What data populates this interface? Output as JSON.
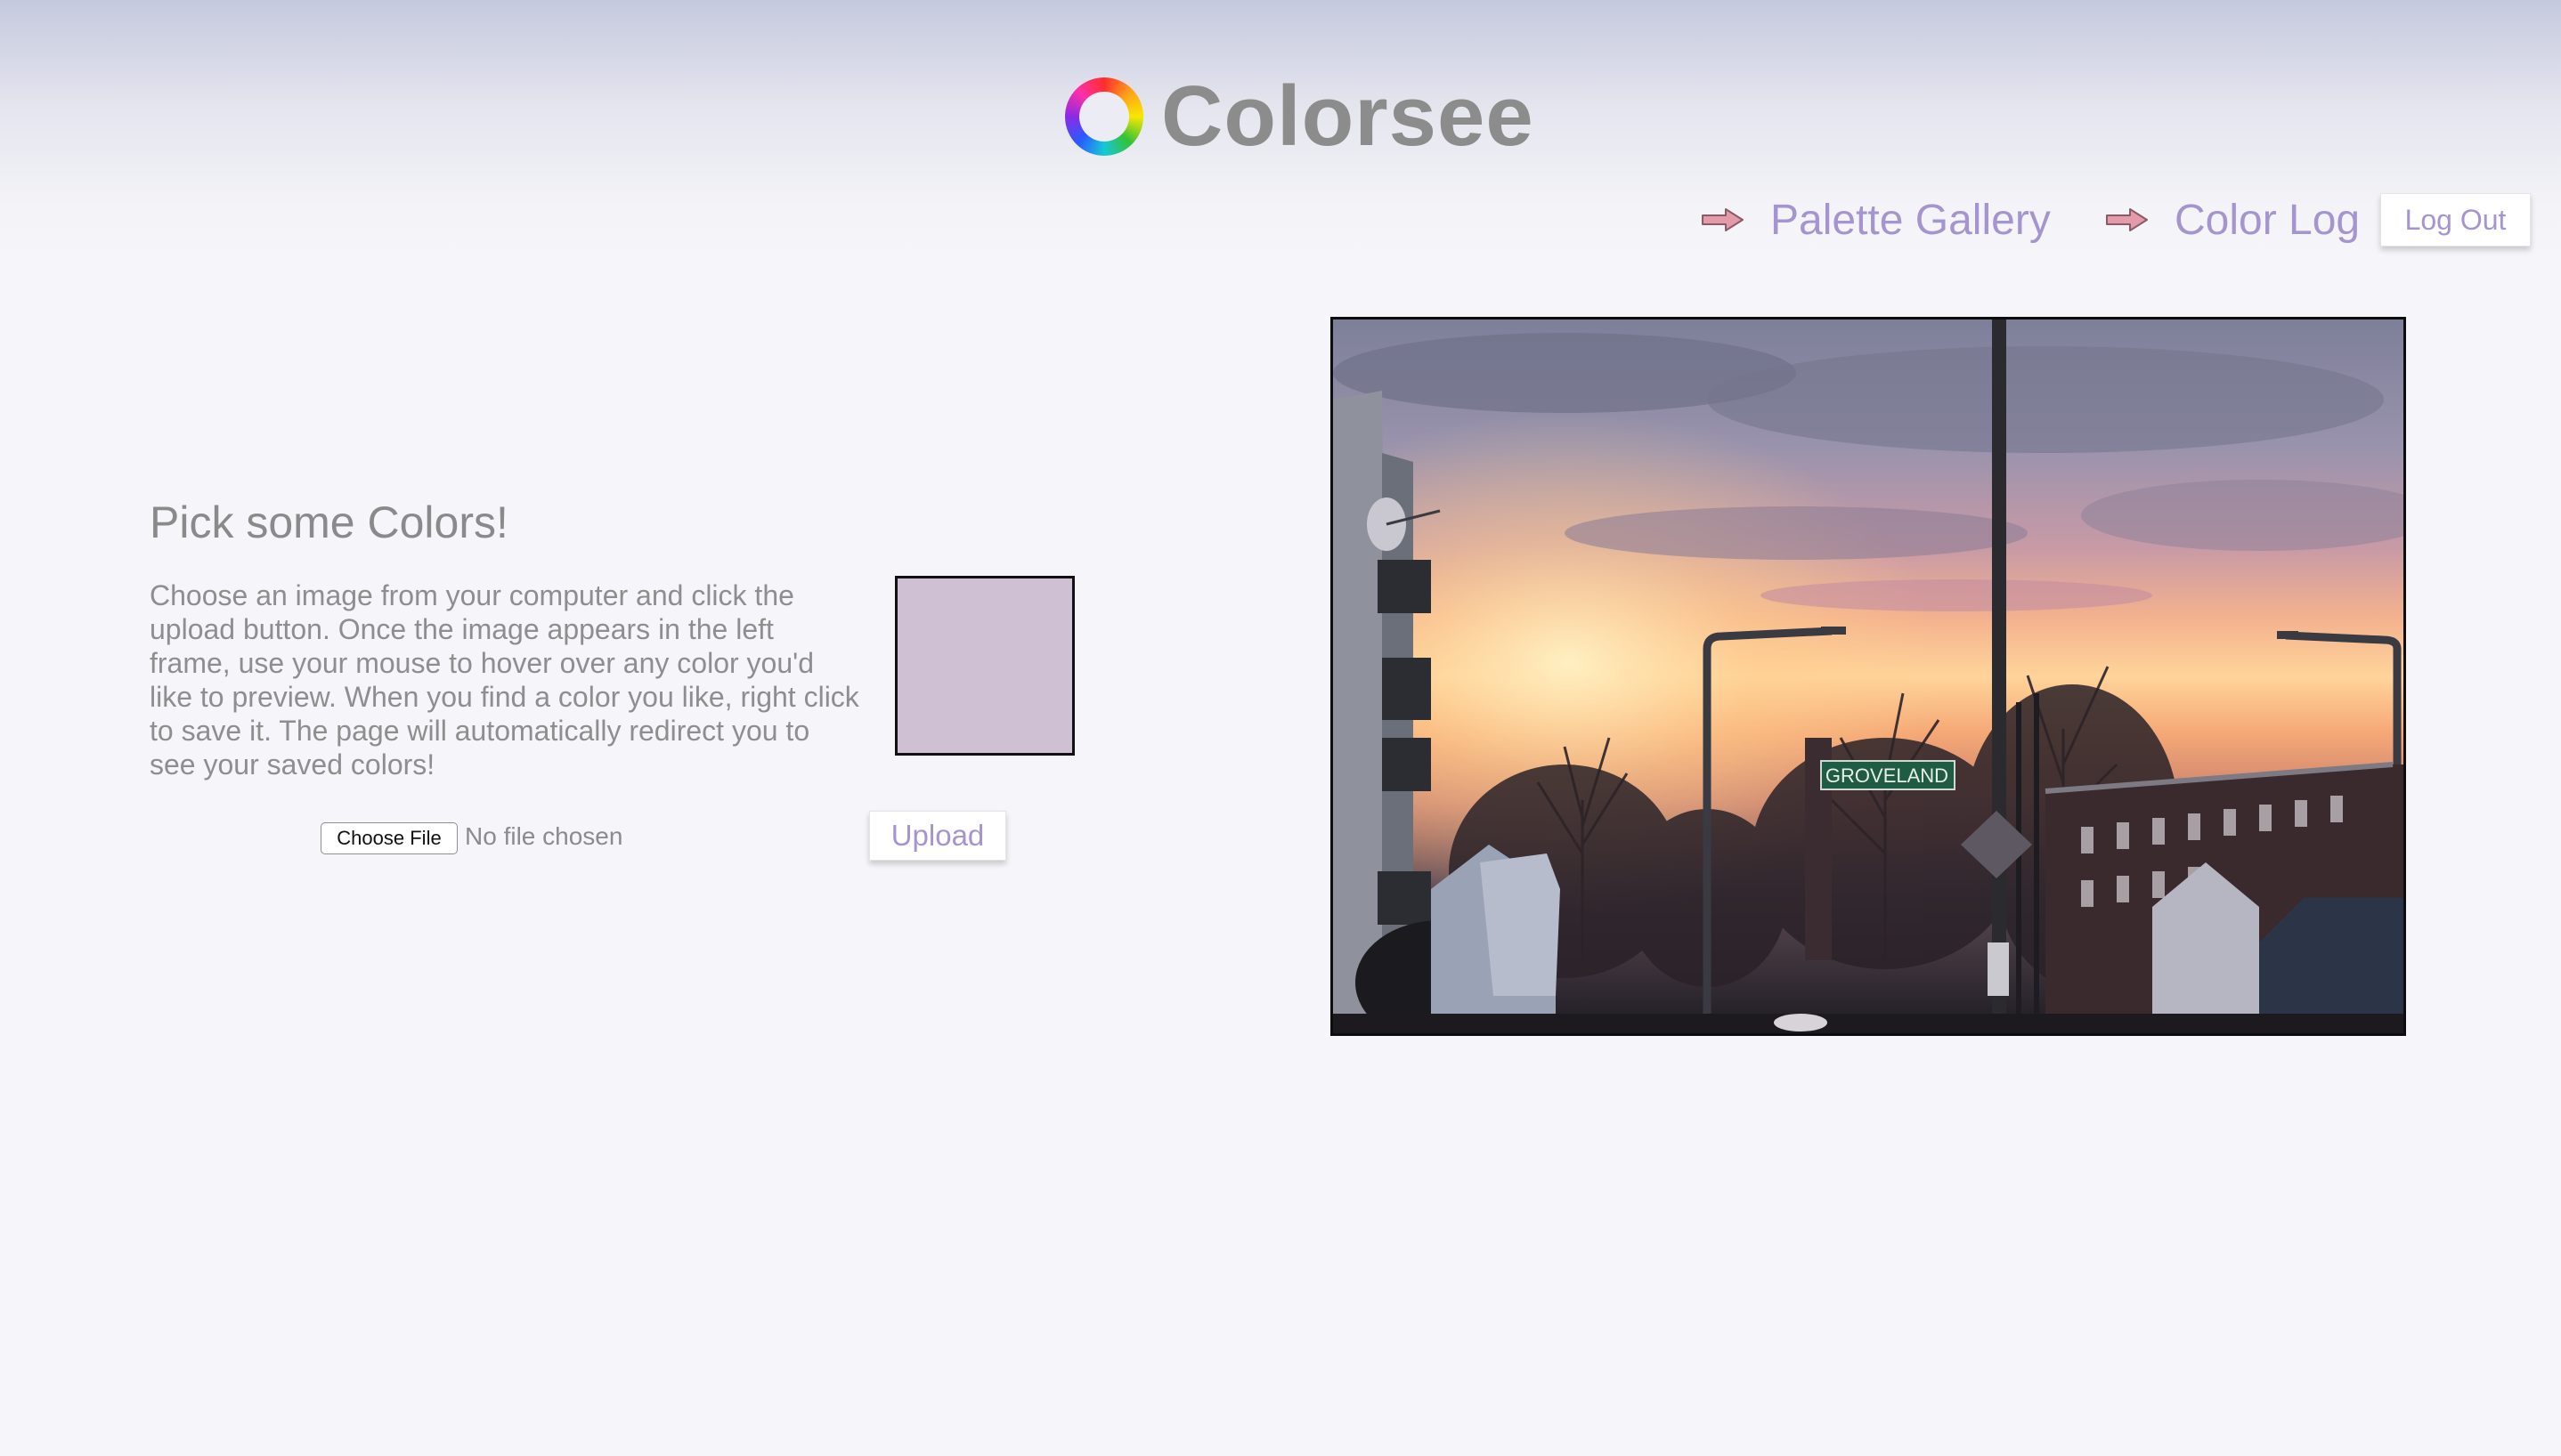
{
  "app": {
    "title": "Colorsee",
    "logo_icon": "color-wheel-icon"
  },
  "nav": {
    "items": [
      {
        "label": "Palette Gallery",
        "icon": "arrow-right-icon"
      },
      {
        "label": "Color Log",
        "icon": "arrow-right-icon"
      }
    ],
    "logout_label": "Log Out"
  },
  "picker": {
    "heading": "Pick some Colors!",
    "instructions": "Choose an image from your computer and click the upload button. Once the image appears in the left frame, use your mouse to hover over any color you'd like to preview. When you find a color you like, right click to save it. The page will automatically redirect you to see your saved colors!",
    "preview_color": "#cfc0d3",
    "file_button_label": "Choose File",
    "file_status": "No file chosen",
    "upload_label": "Upload"
  },
  "image": {
    "sign_text": "GROVELAND"
  },
  "colors": {
    "accent": "#a594cf",
    "arrow": "#e39aaa",
    "logo_text": "#8c8c8c",
    "background": "#f6f6fa"
  }
}
